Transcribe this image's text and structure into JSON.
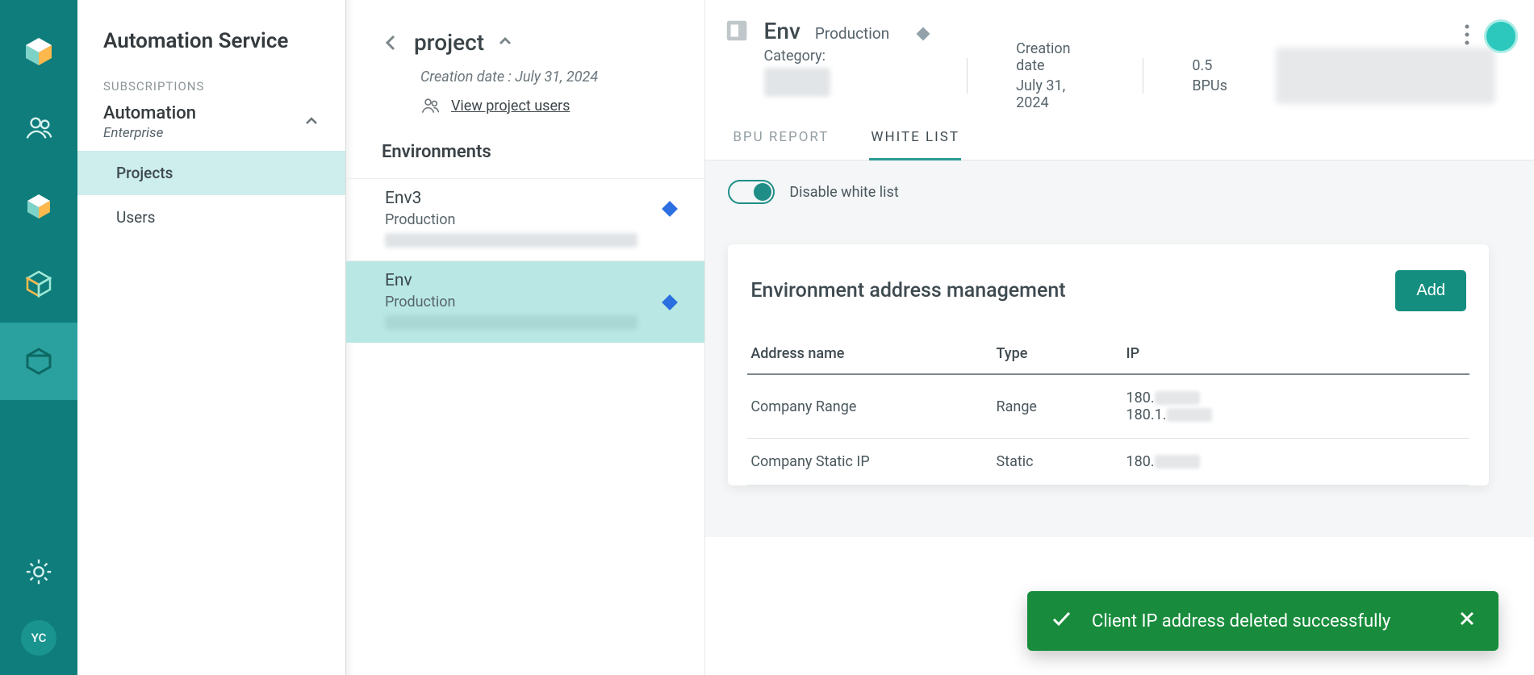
{
  "rail": {
    "avatar_initials": "YC"
  },
  "subs": {
    "panel_title": "Automation Service",
    "section_label": "SUBSCRIPTIONS",
    "group_name": "Automation",
    "group_tier": "Enterprise",
    "items": [
      {
        "label": "Projects",
        "selected": true
      },
      {
        "label": "Users",
        "selected": false
      }
    ]
  },
  "project": {
    "title": "project",
    "creation_label": "Creation date : July 31, 2024",
    "users_link": "View project users",
    "envs_title": "Environments",
    "envs": [
      {
        "name": "Env3",
        "type": "Production",
        "selected": false
      },
      {
        "name": "Env",
        "type": "Production",
        "selected": true
      }
    ]
  },
  "main": {
    "env_name": "Env",
    "env_type": "Production",
    "category_label": "Category:",
    "creation_label": "Creation date",
    "creation_value": "July 31, 2024",
    "bpu_value": "0.5",
    "bpu_label": "BPUs",
    "tabs": [
      {
        "label": "BPU REPORT",
        "active": false
      },
      {
        "label": "WHITE LIST",
        "active": true
      }
    ],
    "toggle_label": "Disable white list",
    "card_title": "Environment address management",
    "add_button": "Add",
    "columns": {
      "name": "Address name",
      "type": "Type",
      "ip": "IP"
    },
    "rows": [
      {
        "name": "Company Range",
        "type": "Range",
        "ip_lines": [
          "180.",
          "180.1."
        ]
      },
      {
        "name": "Company Static IP",
        "type": "Static",
        "ip_lines": [
          "180."
        ]
      }
    ]
  },
  "toast": {
    "message": "Client IP address deleted successfully"
  }
}
